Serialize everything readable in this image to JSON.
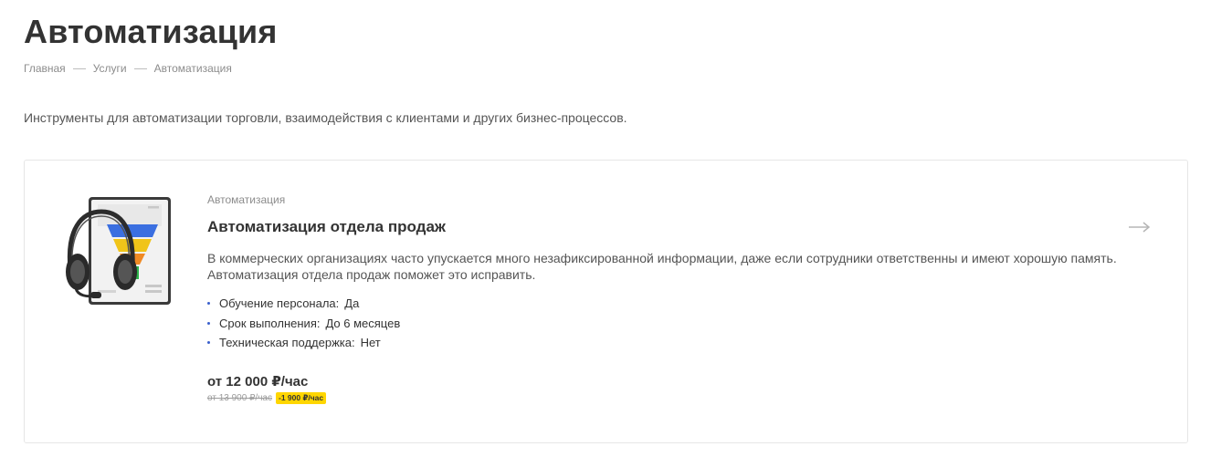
{
  "page": {
    "title": "Автоматизация",
    "intro": "Инструменты для автоматизации торговли, взаимодействия с клиентами и других бизнес-процессов."
  },
  "breadcrumb": {
    "items": [
      "Главная",
      "Услуги",
      "Автоматизация"
    ]
  },
  "product": {
    "category": "Автоматизация",
    "name": "Автоматизация отдела продаж",
    "description": "В коммерческих организациях часто упускается много незафиксированной информации, даже если сотрудники ответственны и имеют хорошую память. Автоматизация отдела продаж поможет это исправить.",
    "properties": [
      {
        "name": "Обучение персонала:",
        "value": "Да"
      },
      {
        "name": "Срок выполнения:",
        "value": "До 6 месяцев"
      },
      {
        "name": "Техническая поддержка:",
        "value": "Нет"
      }
    ],
    "price": "от 12 000 ₽/час",
    "old_price": "от 13 900 ₽/час",
    "discount": "-1 900 ₽/час",
    "image_icon": "headset-sales-funnel-icon",
    "arrow_icon": "arrow-right-icon"
  },
  "colors": {
    "discount_badge": "#ffd600",
    "bullet": "#3a5fcd",
    "text": "#333333",
    "muted": "#8c8c8c"
  }
}
